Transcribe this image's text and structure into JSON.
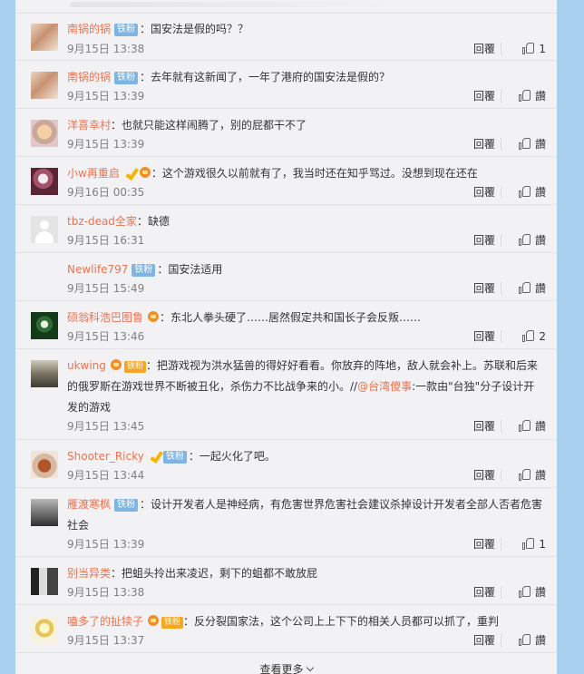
{
  "badge_fan": "铁粉",
  "view_more": "查看更多",
  "reply_label": "回覆",
  "like_label_empty": "讚",
  "comments": [
    {
      "user": "南锅的锅",
      "fan": true,
      "text": "：国安法是假的吗？？",
      "time": "9月15日 13:38",
      "likes": "1"
    },
    {
      "user": "南锅的锅",
      "fan": true,
      "text": "：去年就有这新闻了，一年了港府的国安法是假的？",
      "time": "9月15日 13:39",
      "likes": "讚"
    },
    {
      "user": "洋喜幸村",
      "text": "：也就只能这样闹腾了，别的屁都干不了",
      "time": "9月15日 13:39",
      "likes": "讚"
    },
    {
      "user": "小w再重启",
      "text": "：这个游戏很久以前就有了，我当时还在知乎骂过。没想到现在还在",
      "time": "9月16日 00:35",
      "likes": "讚"
    },
    {
      "user": "tbz-dead全家",
      "text": "：缺德",
      "time": "9月15日 16:31",
      "likes": "讚"
    },
    {
      "user": "Newlife797",
      "fan": true,
      "text": "：国安法适用",
      "time": "9月15日 15:49",
      "likes": "讚"
    },
    {
      "user": "硕翁科浩巴图鲁",
      "text": "：东北人拳头硬了……居然假定共和国长子会反叛……",
      "time": "9月15日 13:46",
      "likes": "2"
    },
    {
      "user": "ukwing",
      "text": "：把游戏视为洪水猛兽的得好好看看。你放弃的阵地，敌人就会补上。苏联和后来的俄罗斯在游戏世界不断被丑化，杀伤力不比战争来的小。//",
      "mention": "@台湾傻事",
      "text2": ":一款由\"台独\"分子设计开发的游戏",
      "time": "9月15日 13:45",
      "likes": "讚"
    },
    {
      "user": "Shooter_Ricky",
      "fan": true,
      "text": "：一起火化了吧。",
      "time": "9月15日 13:44",
      "likes": "讚"
    },
    {
      "user": "雁渡寒枫",
      "fan": true,
      "text": "：设计开发者人是神经病，有危害世界危害社会建议杀掉设计开发者全部人否者危害社会",
      "time": "9月15日 13:39",
      "likes": "1"
    },
    {
      "user": "别当异类",
      "text": "：把蛆头拎出来凌迟，剩下的蛆都不敢放屁",
      "time": "9月15日 13:38",
      "likes": "讚"
    },
    {
      "user": "嗑多了的扯犊子",
      "fan": true,
      "text": "：反分裂国家法，这个公司上上下下的相关人员都可以抓了，重判",
      "time": "9月15日 13:37",
      "likes": "讚"
    }
  ]
}
